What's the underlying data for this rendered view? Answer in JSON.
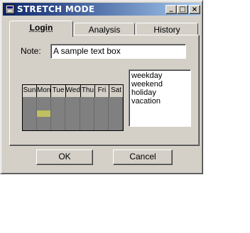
{
  "window": {
    "title": "STRETCH MODE"
  },
  "title_buttons": {
    "minimize": "_",
    "maximize": "□",
    "close": "×"
  },
  "tabs": [
    {
      "label": "Login",
      "active": true
    },
    {
      "label": "Analysis",
      "active": false
    },
    {
      "label": "History",
      "active": false
    }
  ],
  "note": {
    "label": "Note:",
    "value": "A sample text box"
  },
  "calendar": {
    "days": [
      "Sun",
      "Mon",
      "Tue",
      "Wed",
      "Thu",
      "Fri",
      "Sat"
    ]
  },
  "list": {
    "items": [
      "weekday",
      "weekend",
      "holiday",
      "vacation"
    ]
  },
  "buttons": {
    "ok": "OK",
    "cancel": "Cancel"
  }
}
